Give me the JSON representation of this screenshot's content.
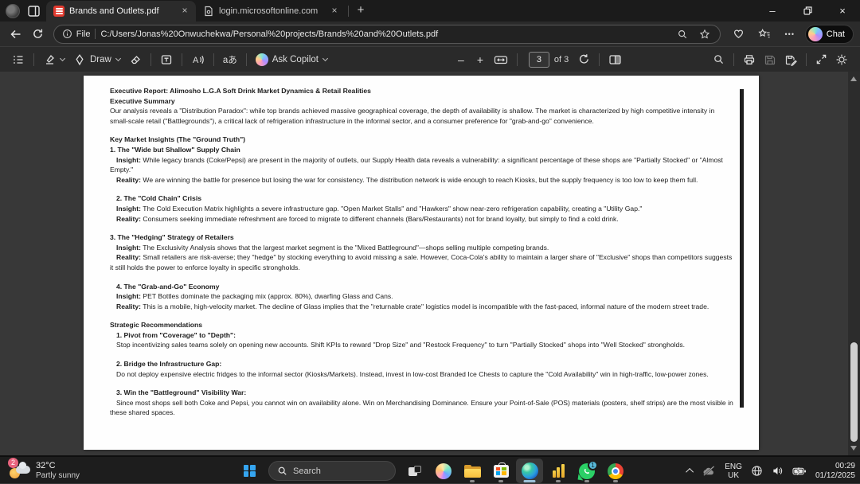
{
  "browser": {
    "tabs": [
      {
        "title": "Brands and Outlets.pdf",
        "active": true
      },
      {
        "title": "login.microsoftonline.com",
        "active": false
      }
    ],
    "address": {
      "scheme_label": "File",
      "url": "C:/Users/Jonas%20Onwuchekwa/Personal%20projects/Brands%20and%20Outlets.pdf"
    },
    "copilot_chat_label": "Chat"
  },
  "icons": {
    "close": "×",
    "new_tab": "+",
    "window_minimize": "–",
    "more_options": "•••",
    "zoom_out": "–",
    "zoom_in": "+"
  },
  "pdf_toolbar": {
    "draw_label": "Draw",
    "translate_label": "aあ",
    "ask_copilot_label": "Ask Copilot",
    "page_number": "3",
    "page_total_label": "of 3"
  },
  "document": {
    "lines": [
      {
        "type": "heading",
        "text": "Executive Report: Alimosho L.G.A Soft Drink Market Dynamics & Retail Realities"
      },
      {
        "type": "heading",
        "text": "Executive Summary"
      },
      {
        "type": "body",
        "text": "Our analysis reveals a \"Distribution Paradox\": while top brands achieved massive geographical coverage, the depth of availability is shallow. The market is characterized by high competitive intensity in small-scale retail (\"Battlegrounds\"), a critical lack of refrigeration infrastructure in the informal sector, and a consumer preference for \"grab-and-go\" convenience."
      },
      {
        "type": "spacer"
      },
      {
        "type": "heading",
        "text": "Key Market Insights (The \"Ground Truth\")"
      },
      {
        "type": "heading",
        "text": "1. The \"Wide but Shallow\" Supply Chain"
      },
      {
        "type": "body",
        "lead": "Insight:",
        "text": " While legacy brands (Coke/Pepsi) are present in the majority of outlets, our Supply Health data reveals a vulnerability: a significant percentage of these shops are \"Partially Stocked\" or \"Almost Empty.\"",
        "indent": true
      },
      {
        "type": "body",
        "lead": "Reality:",
        "text": " We are winning the battle for presence but losing the war for consistency. The distribution network is wide enough to reach Kiosks, but the supply frequency is too low to keep them full.",
        "indent": true
      },
      {
        "type": "spacer"
      },
      {
        "type": "heading",
        "text": "2. The \"Cold Chain\" Crisis",
        "indent": true
      },
      {
        "type": "body",
        "lead": "Insight:",
        "text": " The Cold Execution Matrix highlights a severe infrastructure gap. \"Open Market Stalls\" and \"Hawkers\" show near-zero refrigeration capability, creating a \"Utility Gap.\"",
        "indent": true
      },
      {
        "type": "body",
        "lead": "Reality:",
        "text": " Consumers seeking immediate refreshment are forced to migrate to different channels (Bars/Restaurants) not for brand loyalty, but simply to find a cold drink.",
        "indent": true
      },
      {
        "type": "spacer"
      },
      {
        "type": "heading",
        "text": "3. The \"Hedging\" Strategy of Retailers"
      },
      {
        "type": "body",
        "lead": "Insight:",
        "text": " The Exclusivity Analysis shows that the largest market segment is the \"Mixed Battleground\"—shops selling multiple competing brands.",
        "indent": true
      },
      {
        "type": "body",
        "lead": "Reality:",
        "text": " Small retailers are risk-averse; they \"hedge\" by stocking everything to avoid missing a sale. However, Coca-Cola's ability to maintain a larger share of \"Exclusive\" shops than competitors suggests it still holds the power to enforce loyalty in specific strongholds.",
        "indent": true
      },
      {
        "type": "spacer"
      },
      {
        "type": "heading",
        "text": "4. The \"Grab-and-Go\" Economy",
        "indent": true
      },
      {
        "type": "body",
        "lead": "Insight:",
        "text": " PET Bottles dominate the packaging mix (approx. 80%), dwarfing Glass and Cans.",
        "indent": true
      },
      {
        "type": "body",
        "lead": "Reality:",
        "text": " This is a mobile, high-velocity market. The decline of Glass implies that the \"returnable crate\" logistics model is incompatible with the fast-paced, informal nature of the modern street trade.",
        "indent": true
      },
      {
        "type": "spacer"
      },
      {
        "type": "heading",
        "text": "Strategic Recommendations"
      },
      {
        "type": "heading",
        "text": "1. Pivot from \"Coverage\" to \"Depth\":",
        "indent": true
      },
      {
        "type": "body",
        "text": "Stop incentivizing sales teams solely on opening new accounts. Shift KPIs to reward \"Drop Size\" and \"Restock Frequency\" to turn \"Partially Stocked\" shops into \"Well Stocked\" strongholds.",
        "indent": true
      },
      {
        "type": "spacer"
      },
      {
        "type": "heading",
        "text": "2.  Bridge the Infrastructure Gap:",
        "indent": true
      },
      {
        "type": "body",
        "text": "Do not deploy expensive electric fridges to the informal sector (Kiosks/Markets). Instead, invest in low-cost Branded Ice Chests to capture the \"Cold Availability\" win in high-traffic, low-power zones.",
        "indent": true
      },
      {
        "type": "spacer"
      },
      {
        "type": "heading",
        "text": "3. Win the \"Battleground\" Visibility War:",
        "indent": true
      },
      {
        "type": "body",
        "text": "Since most shops sell both Coke and Pepsi, you cannot win on availability alone. Win on Merchandising Dominance. Ensure your Point-of-Sale (POS) materials (posters, shelf strips) are the most visible in these shared spaces.",
        "indent": true
      }
    ]
  },
  "taskbar": {
    "weather": {
      "badge": "2",
      "temp": "32°C",
      "condition": "Partly sunny"
    },
    "search_placeholder": "Search",
    "whatsapp_badge": "1"
  },
  "tray": {
    "language_line1": "ENG",
    "language_line2": "UK",
    "time": "00:29",
    "date": "01/12/2025"
  }
}
